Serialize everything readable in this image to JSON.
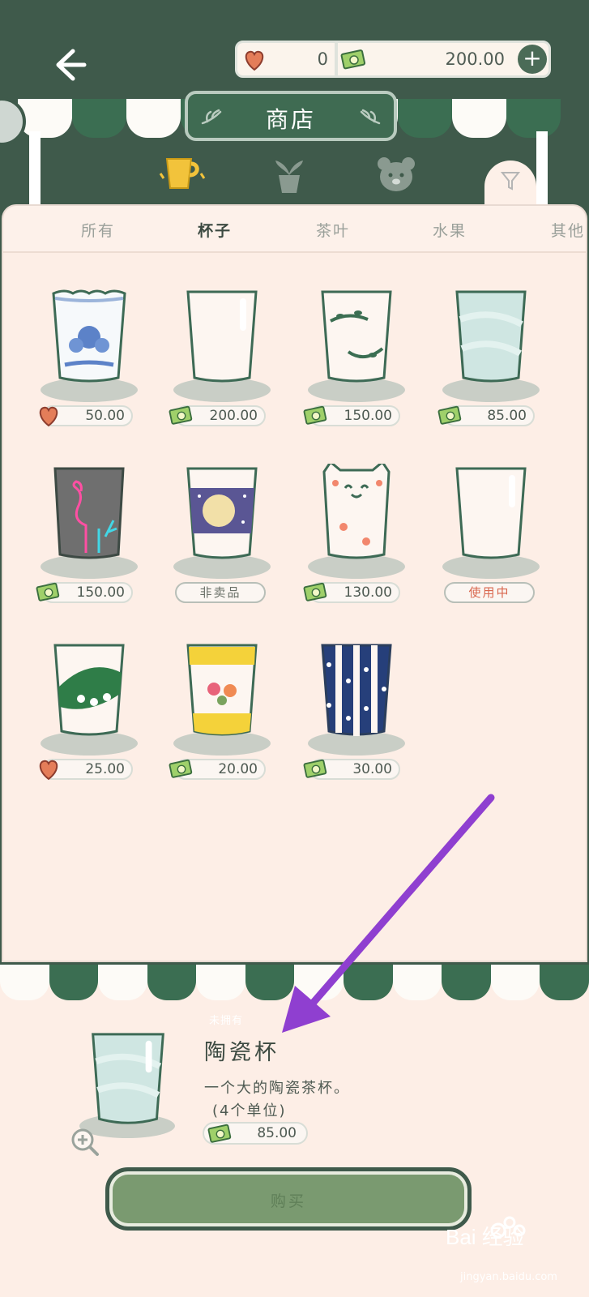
{
  "header": {
    "back_label": "←",
    "hearts": "0",
    "money": "200.00",
    "plus_label": "+"
  },
  "shop_sign": {
    "title": "商店"
  },
  "categories": [
    {
      "name": "cup-category-icon",
      "active": true
    },
    {
      "name": "plant-category-icon",
      "active": false
    },
    {
      "name": "bear-category-icon",
      "active": false
    }
  ],
  "tabs": [
    {
      "label": "所有",
      "active": false
    },
    {
      "label": "杯子",
      "active": true
    },
    {
      "label": "茶叶",
      "active": false
    },
    {
      "label": "水果",
      "active": false
    },
    {
      "label": "其他",
      "active": false
    }
  ],
  "items": [
    {
      "name": "blue-porcelain-cup",
      "currency": "heart",
      "price": "50.00"
    },
    {
      "name": "plain-glass-cup",
      "currency": "money",
      "price": "200.00"
    },
    {
      "name": "vine-cup",
      "currency": "money",
      "price": "150.00"
    },
    {
      "name": "ceramic-cup",
      "currency": "money",
      "price": "85.00"
    },
    {
      "name": "flamingo-neon-cup",
      "currency": "money",
      "price": "150.00"
    },
    {
      "name": "moon-night-cup",
      "currency": "tag",
      "price": "非卖品"
    },
    {
      "name": "cat-cup",
      "currency": "money",
      "price": "130.00"
    },
    {
      "name": "default-cup",
      "currency": "inuse",
      "price": "使用中"
    },
    {
      "name": "lily-of-valley-cup",
      "currency": "heart",
      "price": "25.00"
    },
    {
      "name": "yellow-flower-cup",
      "currency": "money",
      "price": "20.00"
    },
    {
      "name": "blue-dotted-cup",
      "currency": "money",
      "price": "30.00"
    }
  ],
  "detail": {
    "subtitle": "未拥有",
    "name": "陶瓷杯",
    "description": "一个大的陶瓷茶杯。",
    "units": "(4个单位)",
    "price": "85.00",
    "buy_label": "购买"
  },
  "colors": {
    "bg_dark": "#3f5a4b",
    "panel": "#fdeee6",
    "accent_green": "#3b6e52",
    "in_use": "#d9674e",
    "arrow": "#8f3fd0"
  },
  "watermark": {
    "brand": "Bai 经验",
    "url": "jingyan.baidu.com"
  }
}
